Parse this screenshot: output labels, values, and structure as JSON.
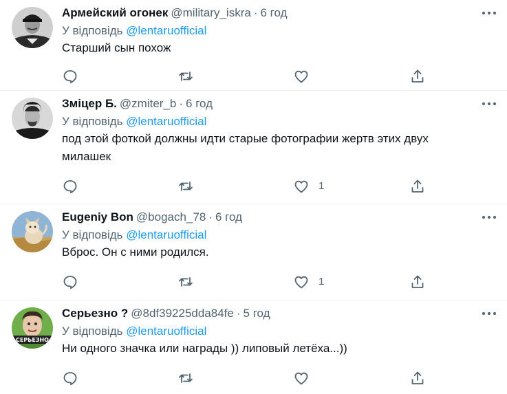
{
  "colors": {
    "text": "#0f1419",
    "muted": "#536471",
    "link": "#1d9bf0",
    "divider": "#eff3f4"
  },
  "icons": [
    "more-icon",
    "reply-icon",
    "retweet-icon",
    "like-icon",
    "share-icon"
  ],
  "tweets": [
    {
      "name": "Армейский огонек",
      "handle": "@military_iskra",
      "separator": "·",
      "time": "6 год",
      "reply_prefix": "У відповідь",
      "reply_to": "@lentaruofficial",
      "text": "Старший сын похож",
      "likes": ""
    },
    {
      "name": "Зміцер Б.",
      "handle": "@zmiter_b",
      "separator": "·",
      "time": "6 год",
      "reply_prefix": "У відповідь",
      "reply_to": "@lentaruofficial",
      "text": "под этой фоткой должны идти старые фотографии жертв этих двух милашек",
      "likes": "1"
    },
    {
      "name": "Eugeniy Bon",
      "handle": "@bogach_78",
      "separator": "·",
      "time": "6 год",
      "reply_prefix": "У відповідь",
      "reply_to": "@lentaruofficial",
      "text": "Вброс. Он с ними родился.",
      "likes": "1"
    },
    {
      "name": "Серьезно ?",
      "handle": "@8df39225dda84fe",
      "separator": "·",
      "time": "5 год",
      "reply_prefix": "У відповідь",
      "reply_to": "@lentaruofficial",
      "text": "Ни одного значка или награды )) липовый летёха...))",
      "likes": "",
      "avatar_text": "СЕРЬЕЗНО"
    }
  ]
}
